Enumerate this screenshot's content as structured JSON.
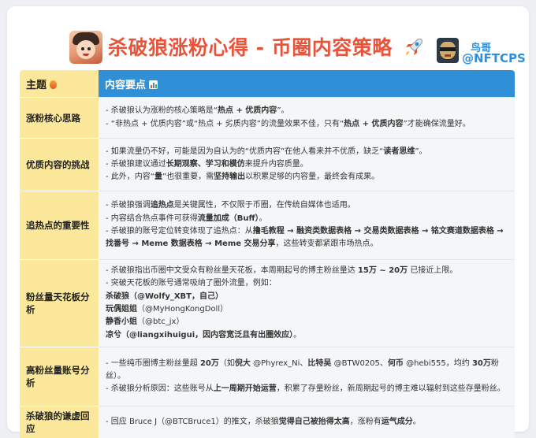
{
  "header": {
    "title": "杀破狼涨粉心得 - 币圈内容策略",
    "author_name": "鸟哥",
    "author_handle": "@NFTCPS"
  },
  "table": {
    "col1_header": "主题",
    "col2_header": "内容要点",
    "rows": [
      {
        "topic": "涨粉核心思路",
        "lines": [
          [
            {
              "t": "- 杀破狼认为涨粉的核心策略是“"
            },
            {
              "t": "热点 + 优质内容",
              "b": true
            },
            {
              "t": "”。"
            }
          ],
          [
            {
              "t": "- “非热点 + 优质内容”或“热点 + 劣质内容”的流量效果不佳，只有“"
            },
            {
              "t": "热点 + 优质内容",
              "b": true
            },
            {
              "t": "”才能确保流量好。"
            }
          ]
        ]
      },
      {
        "topic": "优质内容的挑战",
        "lines": [
          [
            {
              "t": "- 如果流量仍不好，可能是因为自认为的“优质内容”在他人看来并不优质，缺乏“"
            },
            {
              "t": "读者思维",
              "b": true
            },
            {
              "t": "”。"
            }
          ],
          [
            {
              "t": "- 杀破狼建议通过"
            },
            {
              "t": "长期观察、学习和模仿",
              "b": true
            },
            {
              "t": "来提升内容质量。"
            }
          ],
          [
            {
              "t": "- 此外，内容“"
            },
            {
              "t": "量",
              "b": true
            },
            {
              "t": "”也很重要，需"
            },
            {
              "t": "坚持输出",
              "b": true
            },
            {
              "t": "以积累足够的内容量，最终会有成果。"
            }
          ]
        ]
      },
      {
        "topic": "追热点的重要性",
        "lines": [
          [
            {
              "t": "- 杀破狼强调"
            },
            {
              "t": "追热点",
              "b": true
            },
            {
              "t": "是关键属性，不仅限于币圈，在传统自媒体也适用。"
            }
          ],
          [
            {
              "t": "- 内容结合热点事件可获得"
            },
            {
              "t": "流量加成（Buff）",
              "b": true
            },
            {
              "t": "。"
            }
          ],
          [
            {
              "t": "- 杀破狼的账号定位转变体现了追热点：从"
            },
            {
              "t": "撸毛教程 → 融资类数据表格 → 交易类数据表格 → 铭文赛道数据表格 → 找番号 → Meme 数据表格 → Meme 交易分享",
              "b": true
            },
            {
              "t": "，这些转变都紧跟市场热点。"
            }
          ]
        ]
      },
      {
        "topic": "粉丝量天花板分析",
        "lines": [
          [
            {
              "t": "- 杀破狼指出币圈中文受众有粉丝量天花板，本周期起号的博主粉丝量达 "
            },
            {
              "t": "15万 ~ 20万",
              "b": true
            },
            {
              "t": " 已接近上限。"
            }
          ],
          [
            {
              "t": "- 突破天花板的账号通常吸纳了圈外流量，例如："
            }
          ],
          [
            {
              "t": "杀破狼",
              "b": true
            },
            {
              "t": "（@Wolfy_XBT，自己）",
              "b": true
            }
          ],
          [
            {
              "t": "玩偶姐姐",
              "b": true
            },
            {
              "t": "（@MyHongKongDoll）"
            }
          ],
          [
            {
              "t": "静香小姐",
              "b": true
            },
            {
              "t": "（@btc_jx）"
            }
          ],
          [
            {
              "t": "凉兮",
              "b": true
            },
            {
              "t": "（@liangxihuigui，因内容宽泛且有出圈效应）",
              "b": true
            },
            {
              "t": "。"
            }
          ]
        ]
      },
      {
        "topic": "高粉丝量账号分析",
        "lines": [
          [
            {
              "t": "- 一些纯币圈博主粉丝量超 "
            },
            {
              "t": "20万",
              "b": true
            },
            {
              "t": "（如"
            },
            {
              "t": "倪大",
              "b": true
            },
            {
              "t": " @Phyrex_Ni、"
            },
            {
              "t": "比特吴",
              "b": true
            },
            {
              "t": " @BTW0205、"
            },
            {
              "t": "何币",
              "b": true
            },
            {
              "t": " @hebi555，均约 "
            },
            {
              "t": "30万",
              "b": true
            },
            {
              "t": "粉丝）。"
            }
          ],
          [
            {
              "t": "- 杀破狼分析原因：这些账号从"
            },
            {
              "t": "上一周期开始运营",
              "b": true
            },
            {
              "t": "，积累了存量粉丝，新周期起号的博主难以辐射到这些存量粉丝。"
            }
          ]
        ]
      },
      {
        "topic": "杀破狼的谦虚回应",
        "lines": [
          [
            {
              "t": "- 回应 Bruce J（@BTCBruce1）的推文，杀破狼"
            },
            {
              "t": "觉得自己被抬得太高",
              "b": true
            },
            {
              "t": "，涨粉有"
            },
            {
              "t": "运气成分",
              "b": true
            },
            {
              "t": "。"
            }
          ]
        ]
      }
    ]
  }
}
